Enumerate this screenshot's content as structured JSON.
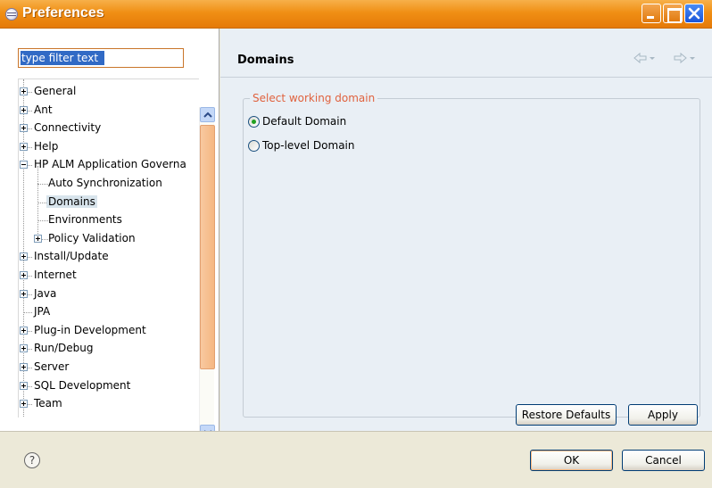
{
  "window": {
    "title": "Preferences",
    "icon": "preferences-icon",
    "controls": [
      "minimize-icon",
      "maximize-icon",
      "close-icon"
    ],
    "title_color": "#f08f14"
  },
  "filter": {
    "placeholder": "type filter text",
    "value": "type filter text"
  },
  "tree": {
    "items": [
      {
        "label": "General",
        "level": 0,
        "expandable": true,
        "expanded": false
      },
      {
        "label": "Ant",
        "level": 0,
        "expandable": true,
        "expanded": false
      },
      {
        "label": "Connectivity",
        "level": 0,
        "expandable": true,
        "expanded": false
      },
      {
        "label": "Help",
        "level": 0,
        "expandable": true,
        "expanded": false
      },
      {
        "label": "HP ALM Application Governa",
        "level": 0,
        "expandable": true,
        "expanded": true
      },
      {
        "label": "Auto Synchronization",
        "level": 1,
        "expandable": false
      },
      {
        "label": "Domains",
        "level": 1,
        "expandable": false,
        "selected": true
      },
      {
        "label": "Environments",
        "level": 1,
        "expandable": false
      },
      {
        "label": "Policy Validation",
        "level": 1,
        "expandable": true,
        "expanded": false
      },
      {
        "label": "Install/Update",
        "level": 0,
        "expandable": true,
        "expanded": false
      },
      {
        "label": "Internet",
        "level": 0,
        "expandable": true,
        "expanded": false
      },
      {
        "label": "Java",
        "level": 0,
        "expandable": true,
        "expanded": false
      },
      {
        "label": "JPA",
        "level": 0,
        "expandable": false
      },
      {
        "label": "Plug-in Development",
        "level": 0,
        "expandable": true,
        "expanded": false
      },
      {
        "label": "Run/Debug",
        "level": 0,
        "expandable": true,
        "expanded": false
      },
      {
        "label": "Server",
        "level": 0,
        "expandable": true,
        "expanded": false
      },
      {
        "label": "SQL Development",
        "level": 0,
        "expandable": true,
        "expanded": false
      },
      {
        "label": "Team",
        "level": 0,
        "expandable": true,
        "expanded": false
      }
    ]
  },
  "page": {
    "title": "Domains",
    "nav_back_icon": "back-arrow-icon",
    "nav_forward_icon": "forward-arrow-icon",
    "group_label": "Select working domain",
    "options": [
      {
        "label": "Default Domain",
        "checked": true
      },
      {
        "label": "Top-level Domain",
        "checked": false
      }
    ],
    "restore_defaults": "Restore Defaults",
    "apply": "Apply"
  },
  "footer": {
    "help_icon": "help-icon",
    "help_glyph": "?",
    "ok": "OK",
    "cancel": "Cancel"
  }
}
